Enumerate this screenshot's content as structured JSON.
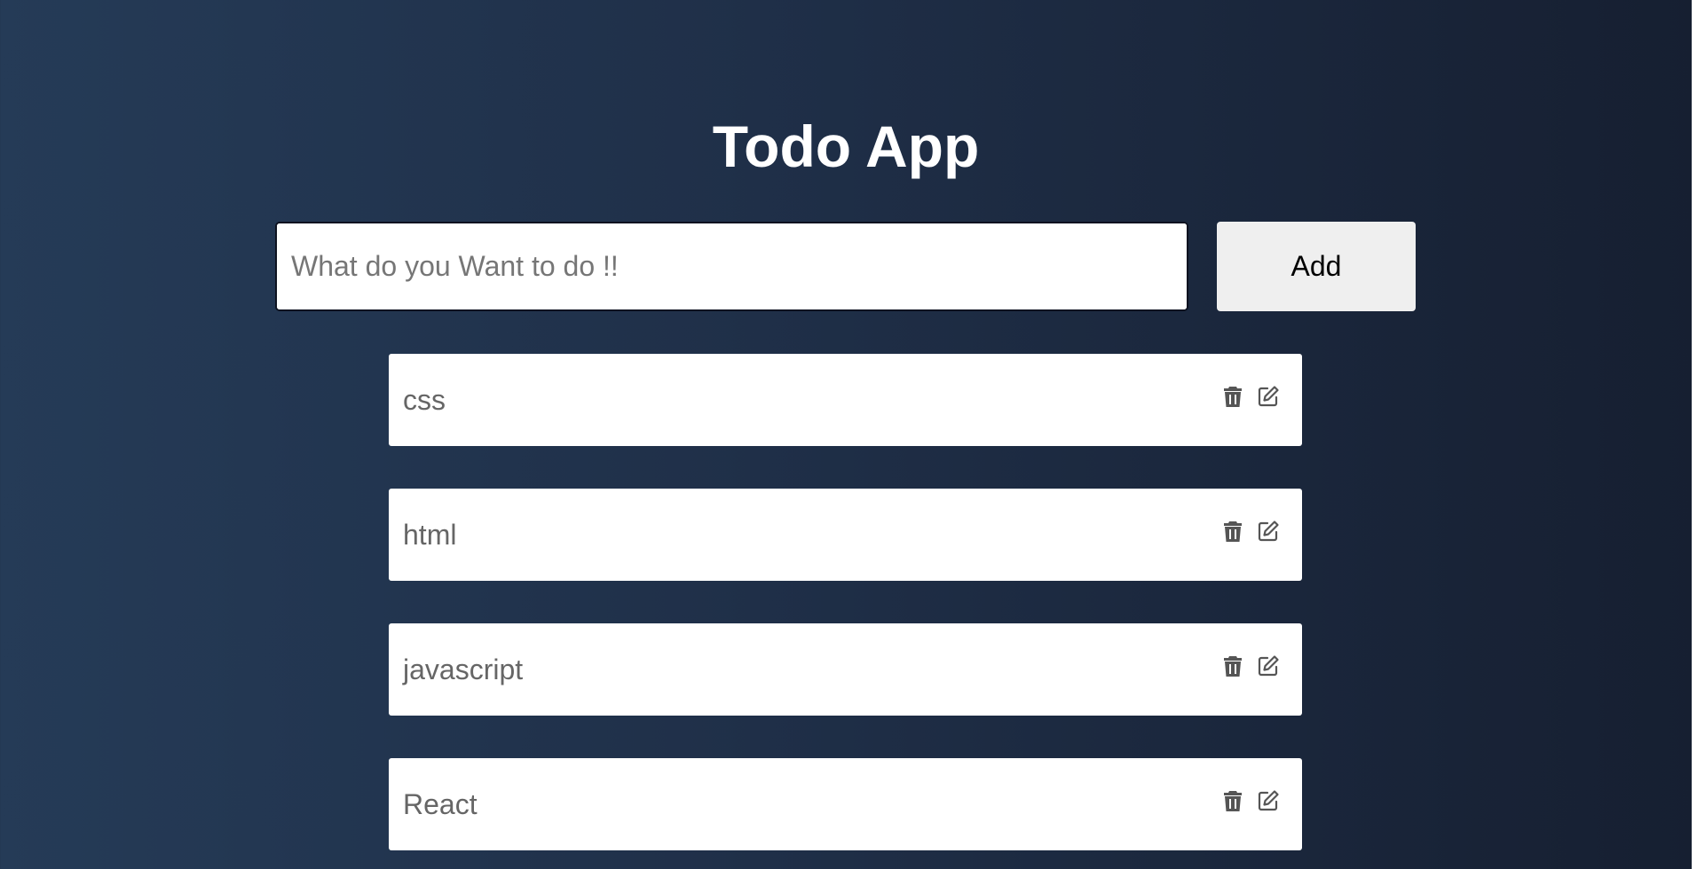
{
  "header": {
    "title": "Todo App"
  },
  "form": {
    "input_value": "",
    "input_placeholder": "What do you Want to do !!",
    "add_label": "Add"
  },
  "todos": [
    {
      "text": "css",
      "icons": [
        "trash-icon",
        "edit-icon"
      ]
    },
    {
      "text": "html",
      "icons": [
        "trash-icon",
        "edit-icon"
      ]
    },
    {
      "text": "javascript",
      "icons": [
        "trash-icon",
        "edit-icon"
      ]
    },
    {
      "text": "React",
      "icons": [
        "trash-icon",
        "edit-icon"
      ]
    }
  ],
  "colors": {
    "background_start": "#253b57",
    "background_end": "#161f31",
    "title": "#ffffff",
    "item_background": "#ffffff",
    "item_text": "#666666",
    "icon": "#555555",
    "button_background": "#efefef"
  }
}
